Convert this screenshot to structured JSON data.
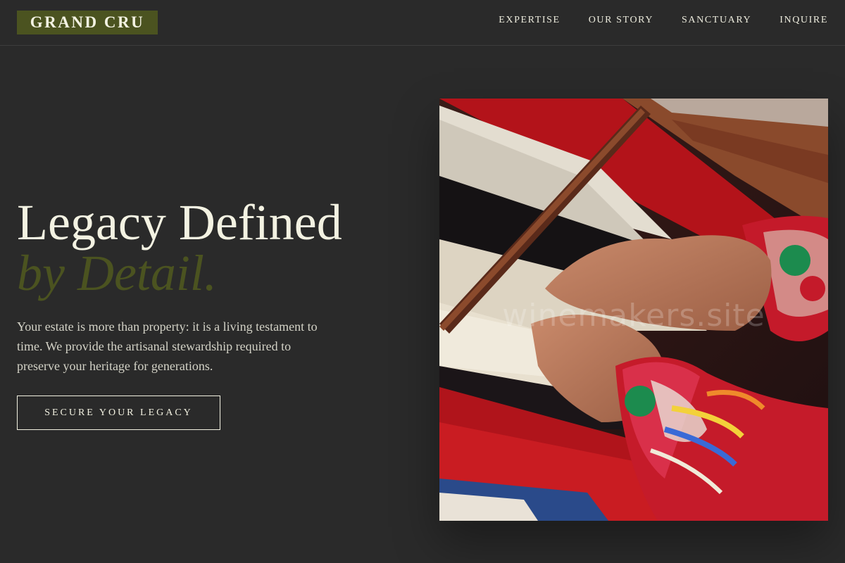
{
  "brand": {
    "name": "GRAND CRU"
  },
  "nav": {
    "items": [
      {
        "label": "EXPERTISE"
      },
      {
        "label": "OUR STORY"
      },
      {
        "label": "SANCTUARY"
      },
      {
        "label": "INQUIRE"
      }
    ]
  },
  "hero": {
    "title_line1": "Legacy Defined",
    "title_line2": "by Detail.",
    "description": "Your estate is more than property: it is a living testament to time. We provide the artisanal stewardship required to preserve your heritage for generations.",
    "cta_label": "SECURE YOUR LEGACY",
    "watermark": "winemakers.site"
  },
  "colors": {
    "background": "#2a2a2a",
    "accent_olive": "#4b5320",
    "cream": "#f3f2e2"
  }
}
